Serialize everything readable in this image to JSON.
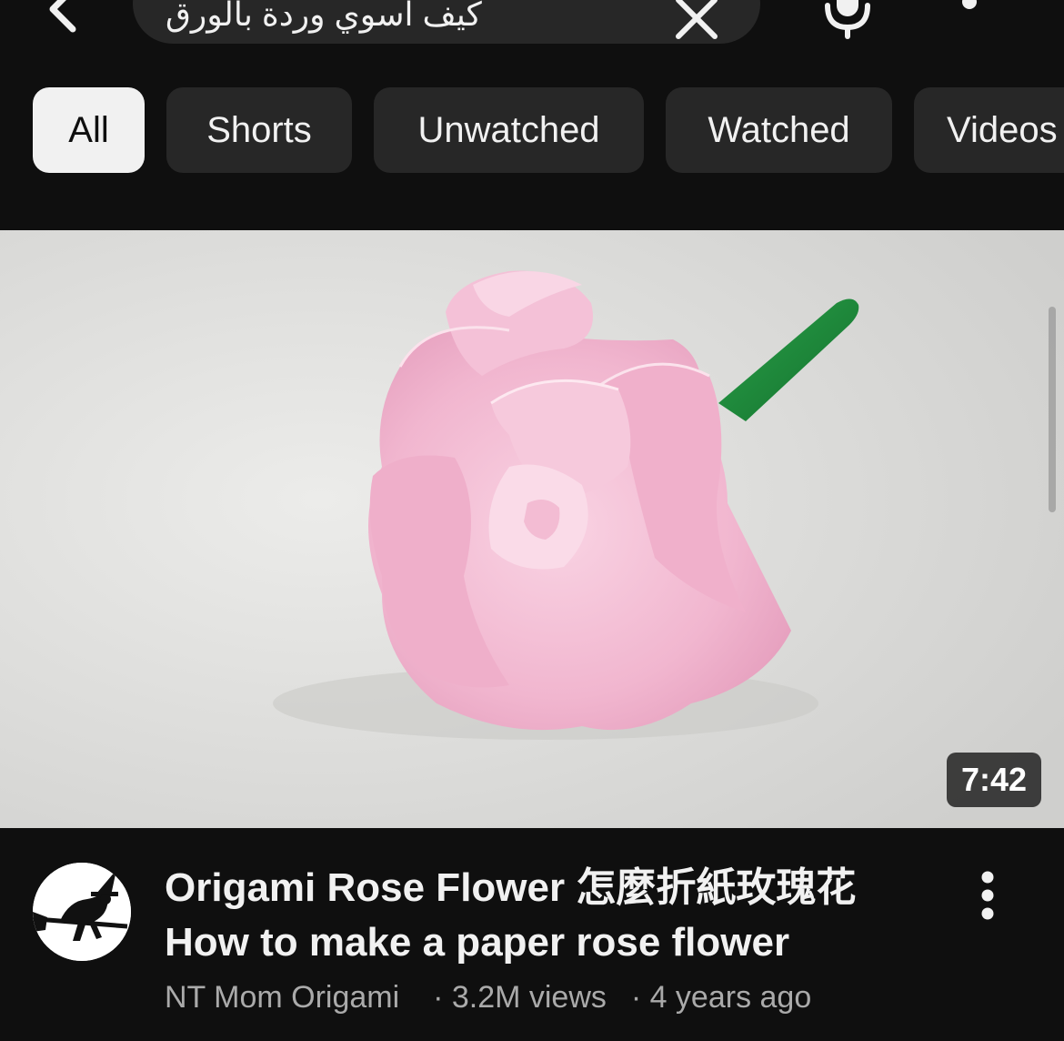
{
  "search": {
    "query": "كيف اسوي وردة بالورق"
  },
  "icons": {
    "back": "chevron-left-icon",
    "clear": "close-icon",
    "mic": "microphone-icon",
    "more": "more-vertical-icon"
  },
  "chips": [
    {
      "label": "All",
      "active": true
    },
    {
      "label": "Shorts",
      "active": false
    },
    {
      "label": "Unwatched",
      "active": false
    },
    {
      "label": "Watched",
      "active": false
    },
    {
      "label": "Videos",
      "active": false
    }
  ],
  "video": {
    "duration": "7:42",
    "title_line1": "Origami Rose Flower 怎麼折紙玫瑰花",
    "title_line2": "How to make a paper rose flower",
    "channel": "NT Mom Origami",
    "views": "· 3.2M views",
    "age": "· 4 years ago"
  },
  "colors": {
    "background": "#0f0f0f",
    "chip_bg": "#272727",
    "chip_active_bg": "#f1f1f1",
    "text_primary": "#f1f1f1",
    "text_secondary": "#aaaaaa",
    "rose_pink": "#f2b9d2",
    "stem_green": "#1f8a3a"
  }
}
